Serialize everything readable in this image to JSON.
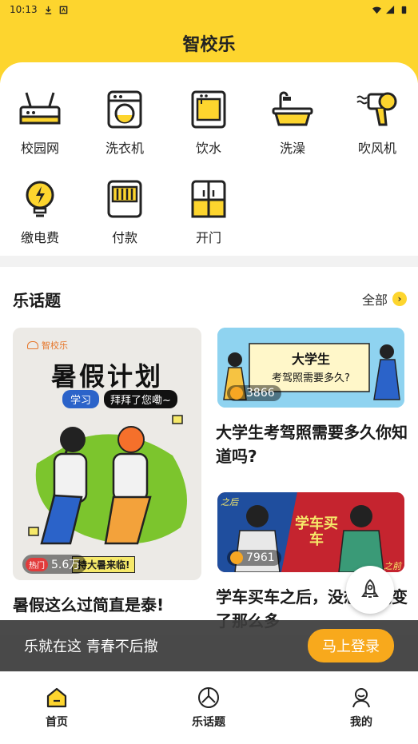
{
  "status_bar": {
    "time": "10:13"
  },
  "header": {
    "title": "智校乐"
  },
  "services": [
    {
      "label": "校园网",
      "icon": "router-icon"
    },
    {
      "label": "洗衣机",
      "icon": "washing-machine-icon"
    },
    {
      "label": "饮水",
      "icon": "water-dispenser-icon"
    },
    {
      "label": "洗澡",
      "icon": "bathtub-icon"
    },
    {
      "label": "吹风机",
      "icon": "hair-dryer-icon"
    },
    {
      "label": "缴电费",
      "icon": "lightbulb-icon"
    },
    {
      "label": "付款",
      "icon": "payment-icon"
    },
    {
      "label": "开门",
      "icon": "door-icon"
    }
  ],
  "topics": {
    "title": "乐话题",
    "all_label": "全部",
    "cards": [
      {
        "title": "暑假这么过简直是泰!",
        "views": "5.6万",
        "hot": "热门",
        "banner_brand": "智校乐",
        "banner_title": "暑假计划",
        "banner_tag1": "学习",
        "banner_tag2": "拜拜了您嘞~",
        "banner_bottom": "持大暑来临!"
      },
      {
        "title": "大学生考驾照需要多久你知道吗?",
        "views": "3866",
        "banner_title": "大学生",
        "banner_sub": "考驾照需要多久?"
      },
      {
        "title": "学车买车之后，没想到我变了那么多",
        "views": "7961",
        "banner_title": "学车买车",
        "banner_left": "之后",
        "banner_right": "之前"
      }
    ]
  },
  "login_prompt": {
    "text": "乐就在这 青春不后撤",
    "button": "马上登录"
  },
  "tabbar": [
    {
      "label": "首页",
      "icon": "home-icon",
      "active": true
    },
    {
      "label": "乐话题",
      "icon": "topic-icon",
      "active": false
    },
    {
      "label": "我的",
      "icon": "profile-icon",
      "active": false
    }
  ],
  "colors": {
    "brand_yellow": "#fdd52e",
    "accent_orange": "#f8a91c"
  }
}
